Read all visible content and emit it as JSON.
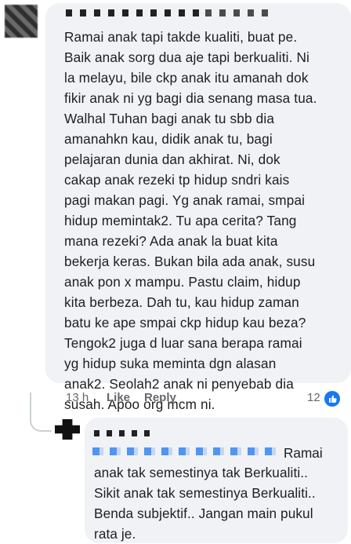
{
  "comment": {
    "text": "Ramai anak tapi takde kualiti, buat pe.\nBaik anak sorg dua aje tapi berkualiti. Ni\nla melayu, bile ckp anak itu amanah dok\nfikir anak ni yg bagi dia senang masa tua.\nWalhal Tuhan bagi anak tu sbb dia\namanahkn kau, didik anak tu, bagi\npelajaran dunia dan akhirat. Ni, dok\ncakap anak rezeki tp hidup sndri kais\npagi makan pagi. Yg anak ramai, smpai\nhidup memintak2. Tu apa cerita? Tang\nmana rezeki? Ada anak la buat kita\nbekerja keras. Bukan bila ada anak, susu\nanak pon x mampu. Pastu claim, hidup\nkita berbeza. Dah tu, kau hidup zaman\nbatu ke ape smpai ckp hidup kau beza?\nTengok2 juga d luar sana berapa ramai\nyg hidup suka meminta dgn alasan\nanak2. Seolah2 anak ni penyebab dia\nsusah. Apoo org mcm ni.",
    "time": "13 h",
    "like_label": "Like",
    "reply_label": "Reply",
    "reaction_count": "12",
    "reaction_icon": "like-thumb-icon",
    "accent_color": "#1877f2"
  },
  "reply": {
    "mention_tail": "Ramai",
    "text": "anak tak semestinya tak Berkualiti..\nSikit anak tak semestinya Berkualiti..\nBenda subjektif.. Jangan main pukul\nrata je."
  }
}
